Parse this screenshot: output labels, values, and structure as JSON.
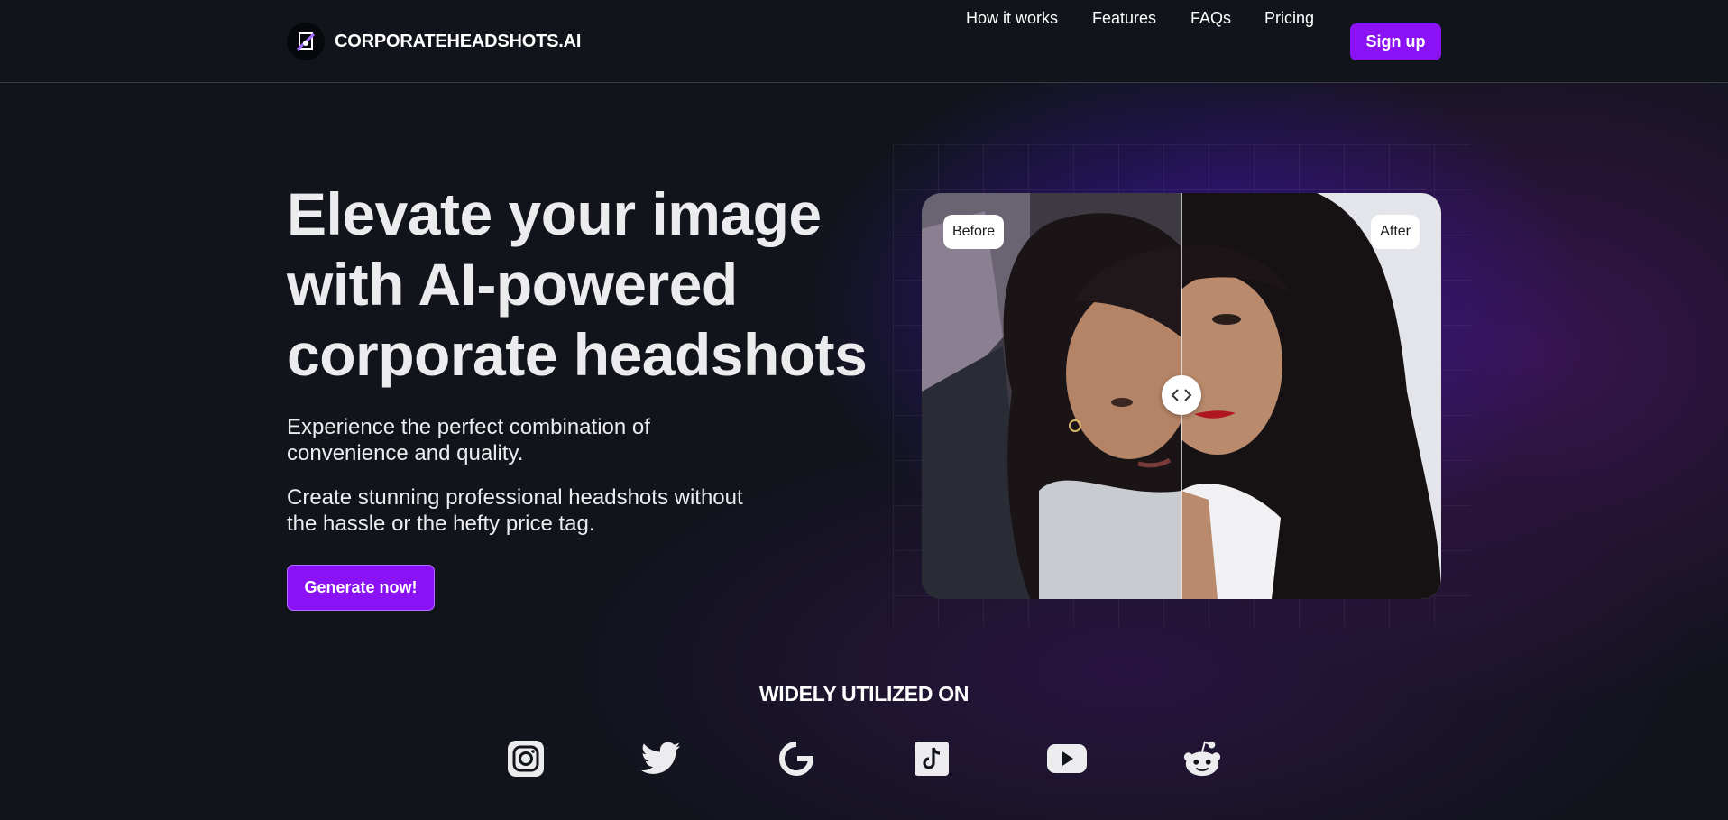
{
  "header": {
    "brand": "CORPORATEHEADSHOTS.AI",
    "nav": [
      {
        "label": "How it works"
      },
      {
        "label": "Features"
      },
      {
        "label": "FAQs"
      },
      {
        "label": "Pricing"
      }
    ],
    "signup_label": "Sign up"
  },
  "hero": {
    "title_lines": [
      "Elevate your image",
      "with AI-powered",
      "corporate headshots"
    ],
    "para1_lines": [
      "Experience the perfect combination of",
      "convenience and quality."
    ],
    "para2_lines": [
      "Create stunning professional headshots without",
      "the hassle or the hefty price tag."
    ],
    "cta_label": "Generate now!"
  },
  "compare": {
    "before_label": "Before",
    "after_label": "After",
    "slider_position_percent": 50
  },
  "used_on": {
    "title": "WIDELY UTILIZED ON",
    "platforms": [
      "instagram-icon",
      "twitter-icon",
      "google-icon",
      "tiktok-icon",
      "youtube-icon",
      "reddit-icon"
    ]
  },
  "colors": {
    "accent": "#8a12f5",
    "background": "#11141b",
    "glow": "#3c14aa"
  }
}
